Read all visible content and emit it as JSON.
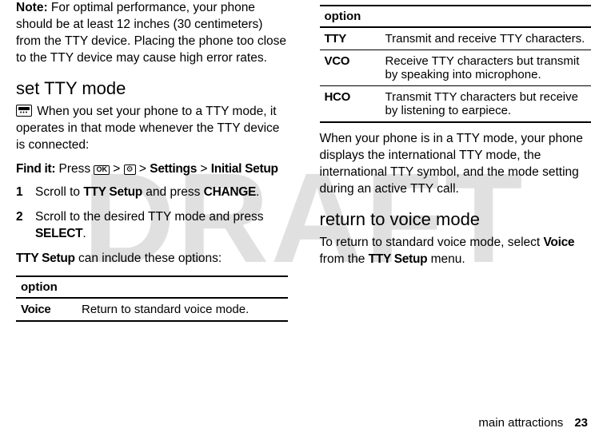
{
  "watermark": "DRAFT",
  "left": {
    "note_label": "Note:",
    "note_body": " For optimal performance, your phone should be at least 12 inches (30 centimeters) from the TTY device. Placing the phone too close to the TTY device may cause high error rates.",
    "heading_set_tty": "set TTY mode",
    "tty_intro": " When you set your phone to a TTY mode, it operates in that mode whenever the TTY device is connected:",
    "findit_label": "Find it:",
    "findit_press": " Press ",
    "ok_key": "OK",
    "gt1": " > ",
    "gear_key": "⚙",
    "gt2": " > ",
    "findit_path1": "Settings",
    "gt3": " > ",
    "findit_path2": "Initial Setup",
    "step1_num": "1",
    "step1_a": "Scroll to ",
    "step1_b": "TTY Setup",
    "step1_c": " and press ",
    "step1_d": "CHANGE",
    "step1_e": ".",
    "step2_num": "2",
    "step2_a": "Scroll to the desired TTY mode and press ",
    "step2_b": "SELECT",
    "step2_c": ".",
    "options_intro_a": "TTY Setup",
    "options_intro_b": " can include these options:",
    "table_header": "option",
    "row_voice_code": "Voice",
    "row_voice_desc": "Return to standard voice mode."
  },
  "right": {
    "table_header": "option",
    "rows": [
      {
        "code": "TTY",
        "desc": "Transmit and receive TTY characters."
      },
      {
        "code": "VCO",
        "desc": "Receive TTY characters but transmit by speaking into microphone."
      },
      {
        "code": "HCO",
        "desc": "Transmit TTY characters but receive by listening to earpiece."
      }
    ],
    "after_table": "When your phone is in a TTY mode, your phone displays the international TTY mode, the international TTY symbol, and the mode setting during an active TTY call.",
    "heading_return": "return to voice mode",
    "return_a": "To return to standard voice mode, select ",
    "return_b": "Voice",
    "return_c": " from the ",
    "return_d": "TTY Setup",
    "return_e": " menu."
  },
  "footer": {
    "section": "main attractions",
    "page": "23"
  }
}
